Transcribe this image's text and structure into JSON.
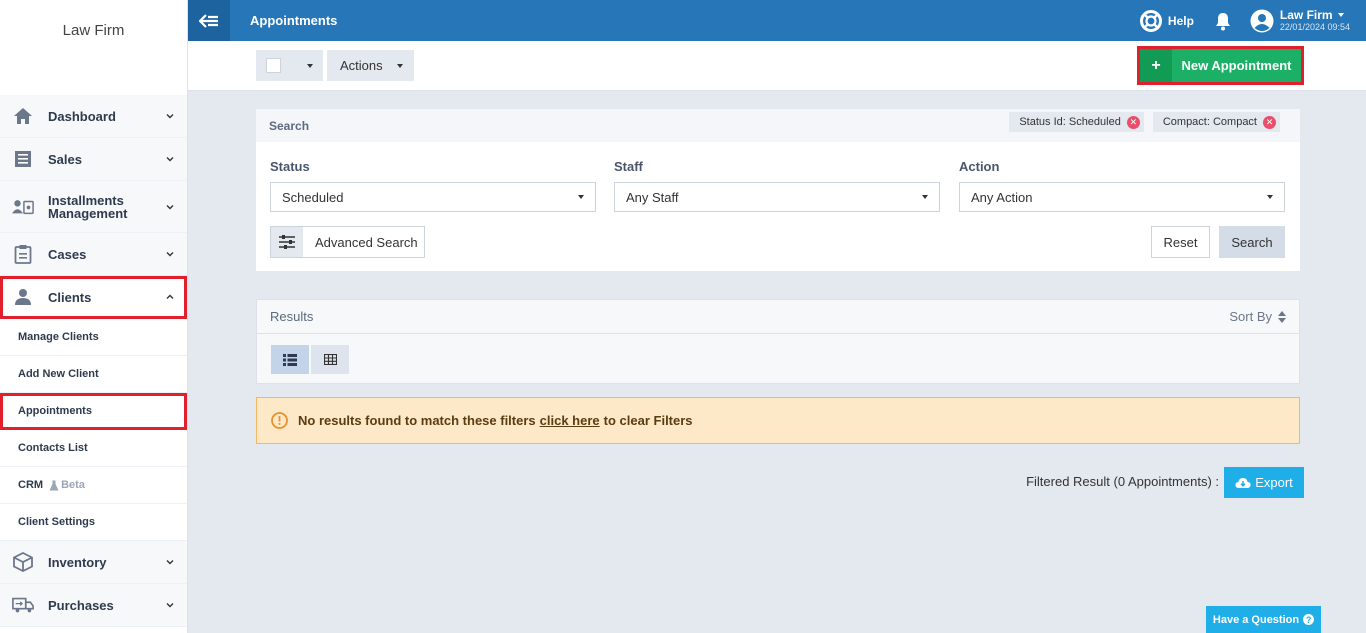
{
  "brand": "Law Firm",
  "topbar": {
    "title": "Appointments",
    "help": "Help",
    "user_name": "Law Firm",
    "user_date": "22/01/2024 09:54"
  },
  "sidebar": {
    "items": [
      {
        "label": "Dashboard",
        "icon": "home-icon"
      },
      {
        "label": "Sales",
        "icon": "invoice-icon"
      },
      {
        "label": "Installments Management",
        "icon": "installments-icon"
      },
      {
        "label": "Cases",
        "icon": "clipboard-icon"
      },
      {
        "label": "Clients",
        "icon": "client-icon"
      }
    ],
    "sub_items": [
      "Manage Clients",
      "Add New Client",
      "Appointments",
      "Contacts List",
      "CRM",
      "Client Settings"
    ],
    "crm_badge": "Beta",
    "items_after": [
      {
        "label": "Inventory",
        "icon": "box-icon"
      },
      {
        "label": "Purchases",
        "icon": "truck-icon"
      }
    ]
  },
  "toolbar": {
    "actions_label": "Actions",
    "new_appointment_label": "New Appointment"
  },
  "search": {
    "title": "Search",
    "chips": [
      "Status Id: Scheduled",
      "Compact: Compact"
    ],
    "status_label": "Status",
    "status_value": "Scheduled",
    "staff_label": "Staff",
    "staff_value": "Any Staff",
    "action_label": "Action",
    "action_value": "Any Action",
    "advanced_label": "Advanced Search",
    "reset_label": "Reset",
    "search_label": "Search"
  },
  "results": {
    "title": "Results",
    "sort_label": "Sort By"
  },
  "alert": {
    "before": "No results found to match these filters",
    "link": "click here",
    "after": "to clear Filters"
  },
  "footer": {
    "filtered_text": "Filtered Result (0 Appointments) :",
    "export_label": "Export",
    "question_label": "Have a Question"
  },
  "colors": {
    "topbar": "#2676b8",
    "new_button": "#1cb066",
    "export": "#1faee8",
    "highlight": "#e0202d"
  }
}
